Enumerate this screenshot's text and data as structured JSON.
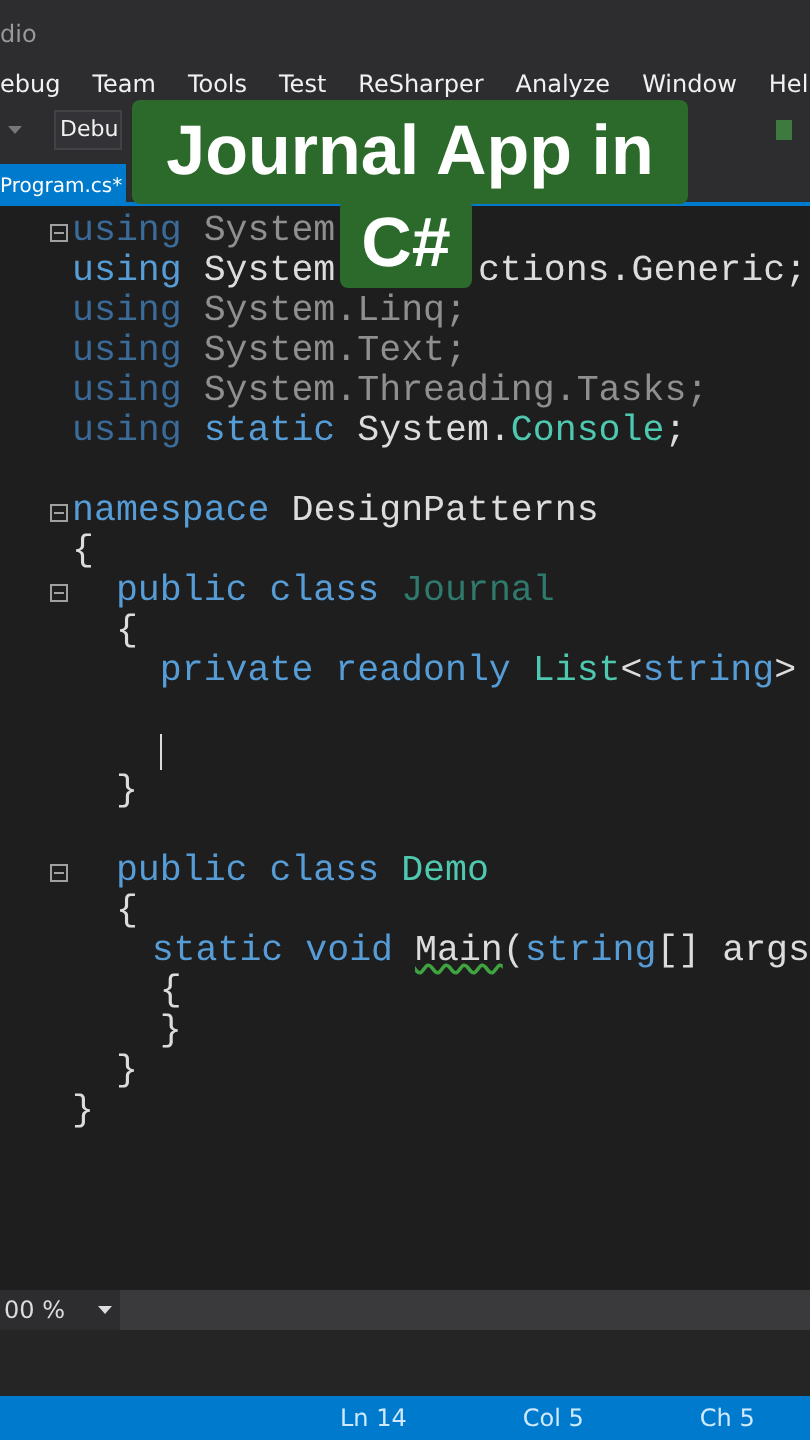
{
  "window": {
    "title": "dio"
  },
  "menu": [
    {
      "label": "ebug"
    },
    {
      "label": "Team"
    },
    {
      "label": "Tools"
    },
    {
      "label": "Test"
    },
    {
      "label": "ReSharper"
    },
    {
      "label": "Analyze"
    },
    {
      "label": "Window"
    },
    {
      "label": "Hel"
    }
  ],
  "toolbar": {
    "config_combo": "Debu"
  },
  "tabs": [
    {
      "label": "Program.cs*",
      "selected": true
    }
  ],
  "caption": [
    "Journal App in",
    "C#"
  ],
  "editor": {
    "lines": [
      {
        "fold": true,
        "tokens": [
          {
            "text": "using",
            "kind": "keyword_faded"
          },
          {
            "text": " System",
            "kind": "faded"
          }
        ]
      },
      {
        "fold": false,
        "tokens": [
          {
            "text": "using",
            "kind": "keyword"
          },
          {
            "text": " System",
            "kind": "plain"
          },
          {
            "text": "ctions.Generic;",
            "kind": "plain",
            "after_caption": true
          }
        ]
      },
      {
        "fold": false,
        "tokens": [
          {
            "text": "using",
            "kind": "keyword_faded"
          },
          {
            "text": " System.Linq;",
            "kind": "faded"
          }
        ]
      },
      {
        "fold": false,
        "tokens": [
          {
            "text": "using",
            "kind": "keyword_faded"
          },
          {
            "text": " System.Text;",
            "kind": "faded"
          }
        ]
      },
      {
        "fold": false,
        "tokens": [
          {
            "text": "using",
            "kind": "keyword_faded"
          },
          {
            "text": " System.Threading.Tasks;",
            "kind": "faded"
          }
        ]
      },
      {
        "fold": false,
        "tokens": [
          {
            "text": "using",
            "kind": "keyword_faded"
          },
          {
            "text": " static",
            "kind": "keyword"
          },
          {
            "text": " System.",
            "kind": "plain"
          },
          {
            "text": "Console",
            "kind": "type"
          },
          {
            "text": ";",
            "kind": "plain"
          }
        ]
      },
      {
        "fold": false
      },
      {
        "fold": true,
        "tokens": [
          {
            "text": "namespace",
            "kind": "keyword"
          },
          {
            "text": " DesignPatterns",
            "kind": "plain"
          }
        ]
      },
      {
        "fold": false,
        "tokens": [
          {
            "text": "{",
            "kind": "plain"
          }
        ],
        "children": [
          {
            "fold": true,
            "tokens": [
              {
                "text": "public class",
                "kind": "keyword"
              },
              {
                "text": " Journal",
                "kind": "type_faded"
              }
            ]
          },
          {
            "fold": false,
            "tokens": [
              {
                "text": "{",
                "kind": "plain"
              }
            ],
            "children": [
              {
                "fold": false,
                "tokens": [
                  {
                    "text": "private readonly",
                    "kind": "keyword"
                  },
                  {
                    "text": " List",
                    "kind": "type"
                  },
                  {
                    "text": "<",
                    "kind": "plain"
                  },
                  {
                    "text": "string",
                    "kind": "keyword"
                  },
                  {
                    "text": ">",
                    "kind": "plain"
                  }
                ]
              },
              {
                "fold": false
              },
              {
                "fold": false,
                "cursor": true
              }
            ]
          },
          {
            "fold": false,
            "tokens": [
              {
                "text": "}",
                "kind": "plain"
              }
            ]
          },
          {
            "fold": false
          },
          {
            "fold": true,
            "tokens": [
              {
                "text": "public class",
                "kind": "keyword"
              },
              {
                "text": " Demo",
                "kind": "type"
              }
            ]
          },
          {
            "fold": false,
            "tokens": [
              {
                "text": "{",
                "kind": "plain"
              }
            ],
            "children": [
              {
                "fold": false,
                "tokens": [
                  {
                    "text": "static void",
                    "kind": "keyword"
                  },
                  {
                    "text": " Main",
                    "kind": "squiggle"
                  },
                  {
                    "text": "(",
                    "kind": "plain"
                  },
                  {
                    "text": "string",
                    "kind": "keyword"
                  },
                  {
                    "text": "[] args",
                    "kind": "plain"
                  }
                ]
              },
              {
                "fold": false,
                "tokens": [
                  {
                    "text": "{",
                    "kind": "plain"
                  }
                ]
              },
              {
                "fold": false,
                "tokens": [
                  {
                    "text": "}",
                    "kind": "plain"
                  }
                ]
              }
            ]
          },
          {
            "fold": false,
            "tokens": [
              {
                "text": "}",
                "kind": "plain"
              }
            ]
          }
        ]
      },
      {
        "fold": false,
        "tokens": [
          {
            "text": "}",
            "kind": "plain"
          }
        ]
      }
    ]
  },
  "zoom": "00 %",
  "status_bar": {
    "line": "Ln 14",
    "column": "Col 5",
    "char": "Ch 5"
  }
}
